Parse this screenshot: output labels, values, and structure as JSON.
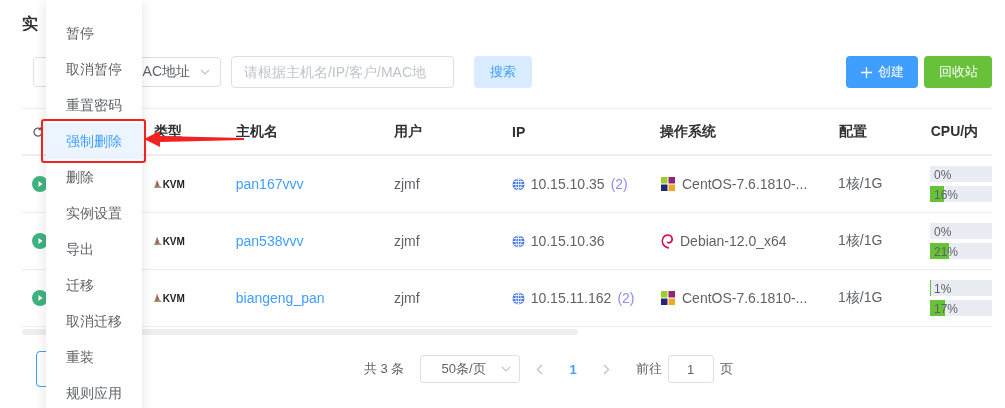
{
  "page": {
    "title": "实"
  },
  "filter": {
    "select_value": "AC地址",
    "search_placeholder": "请根据主机名/IP/客户/MAC地",
    "search_button": "搜索"
  },
  "actions": [
    {
      "label": "创建",
      "kind": "primary"
    },
    {
      "label": "回收站",
      "kind": "success"
    }
  ],
  "table": {
    "columns": [
      "类型",
      "主机名",
      "用户",
      "IP",
      "操作系统",
      "配置",
      "CPU/内"
    ],
    "rows": [
      {
        "type": "KVM",
        "hostname": "pan167vvv",
        "user": "zjmf",
        "ip": "10.15.10.35",
        "ip_count": "(2)",
        "os": {
          "name": "CentOS-7.6.1810-...",
          "kind": "centos"
        },
        "config": "1核/1G",
        "cpu": {
          "reading": "0%",
          "level": 0
        },
        "memory": {
          "reading": "16%",
          "level": 0.16
        }
      },
      {
        "type": "KVM",
        "hostname": "pan538vvv",
        "user": "zjmf",
        "ip": "10.15.10.36",
        "os": {
          "name": "Debian-12.0_x64",
          "kind": "debian"
        },
        "config": "1核/1G",
        "cpu": {
          "reading": "0%",
          "level": 0
        },
        "memory": {
          "reading": "21%",
          "level": 0.21
        }
      },
      {
        "type": "KVM",
        "hostname": "biangeng_pan",
        "user": "zjmf",
        "ip": "10.15.11.162",
        "ip_count": "(2)",
        "os": {
          "name": "CentOS-7.6.1810-...",
          "kind": "centos"
        },
        "config": "1核/1G",
        "cpu": {
          "reading": "1%",
          "level": 0.01
        },
        "memory": {
          "reading": "17%",
          "level": 0.17
        }
      }
    ]
  },
  "pagination": {
    "total": "共 3 条",
    "page_size": "50条/页",
    "pages": [
      {
        "label": "1",
        "selected": true
      }
    ],
    "goto_label": "前往",
    "goto_value": "1",
    "goto_suffix": "页"
  },
  "menu": {
    "items": [
      {
        "label": "暂停",
        "selected": false
      },
      {
        "label": "取消暂停",
        "selected": false
      },
      {
        "label": "重置密码",
        "selected": false
      },
      {
        "label": "强制删除",
        "selected": true
      },
      {
        "label": "删除",
        "selected": false
      },
      {
        "label": "实例设置",
        "selected": false
      },
      {
        "label": "导出",
        "selected": false
      },
      {
        "label": "迁移",
        "selected": false
      },
      {
        "label": "取消迁移",
        "selected": false
      },
      {
        "label": "重装",
        "selected": false
      },
      {
        "label": "规则应用",
        "selected": false
      }
    ]
  }
}
